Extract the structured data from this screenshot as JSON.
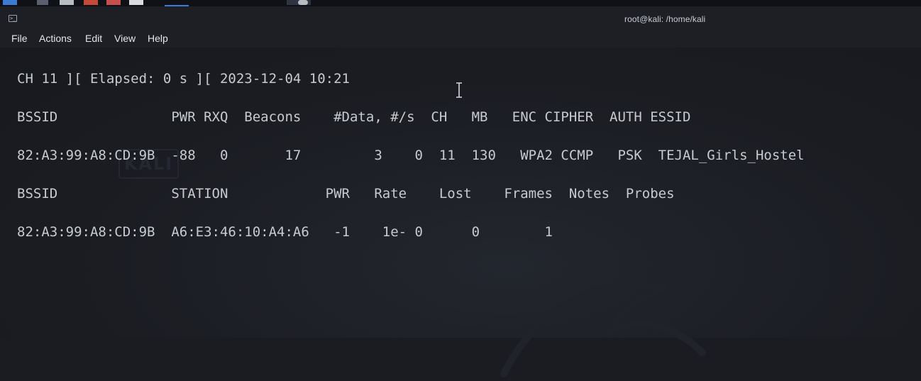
{
  "window": {
    "title": "root@kali: /home/kali"
  },
  "menu": {
    "items": [
      "File",
      "Actions",
      "Edit",
      "View",
      "Help"
    ]
  },
  "terminal": {
    "status_line": "CH 11 ][ Elapsed: 0 s ][ 2023-12-04 10:21",
    "ap_header": "BSSID              PWR RXQ  Beacons    #Data, #/s  CH   MB   ENC CIPHER  AUTH ESSID",
    "ap_row": "82:A3:99:A8:CD:9B  -88   0       17         3    0  11  130   WPA2 CCMP   PSK  TEJAL_Girls_Hostel",
    "station_header": "BSSID              STATION            PWR   Rate    Lost    Frames  Notes  Probes",
    "station_row": "82:A3:99:A8:CD:9B  A6:E3:46:10:A4:A6   -1    1e- 0      0        1"
  },
  "watermark": {
    "label": "KALI"
  }
}
